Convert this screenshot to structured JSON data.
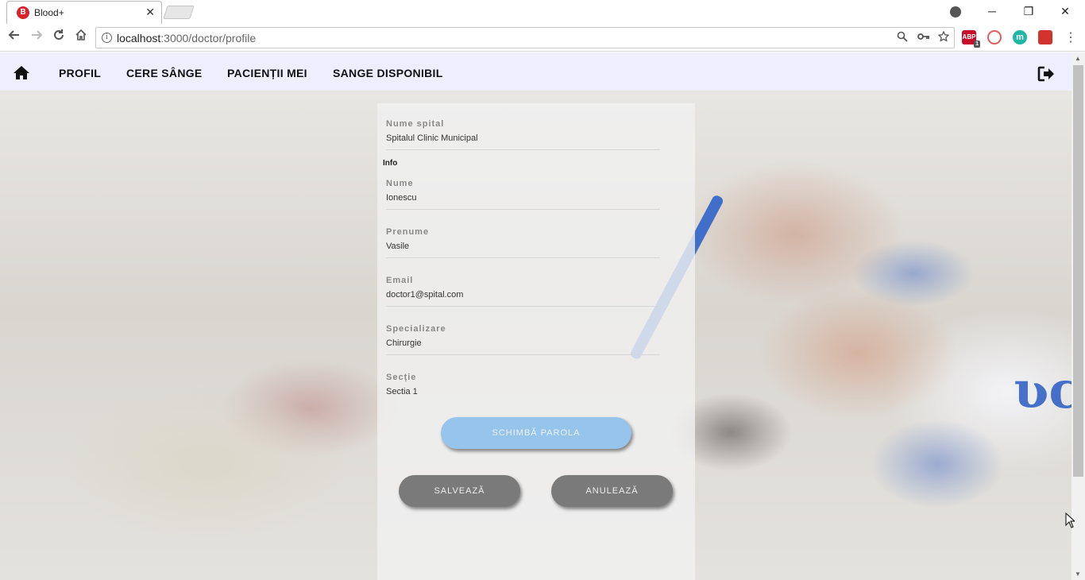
{
  "browser": {
    "tab_title": "Blood+",
    "favicon_text": "B",
    "tab_close": "✕",
    "url_host": "localhost",
    "url_rest": ":3000/doctor/profile",
    "abp_badge": "1",
    "abp_label": "ABP",
    "ext_m": "m",
    "window_min": "─",
    "window_max": "❐",
    "window_close": "✕"
  },
  "nav": {
    "links": [
      "PROFIL",
      "CERE SÂNGE",
      "PACIENȚII MEI",
      "SANGE DISPONIBIL"
    ]
  },
  "profile": {
    "spital_label": "Nume spital",
    "spital_value": "Spitalul Clinic Municipal",
    "info_heading": "Info",
    "nume_label": "Nume",
    "nume_value": "Ionescu",
    "prenume_label": "Prenume",
    "prenume_value": "Vasile",
    "email_label": "Email",
    "email_value": "doctor1@spital.com",
    "spec_label": "Specializare",
    "spec_value": "Chirurgie",
    "sectie_label": "Secție",
    "sectie_value": "Sectia 1"
  },
  "buttons": {
    "change_password": "SCHIMBĂ PAROLA",
    "save": "SALVEAZĂ",
    "cancel": "ANULEAZĂ"
  },
  "colors": {
    "navbar_bg": "#eeeeff",
    "password_button": "#97c4ea",
    "action_button": "#7a7a7a",
    "brand_red": "#d9232a"
  }
}
